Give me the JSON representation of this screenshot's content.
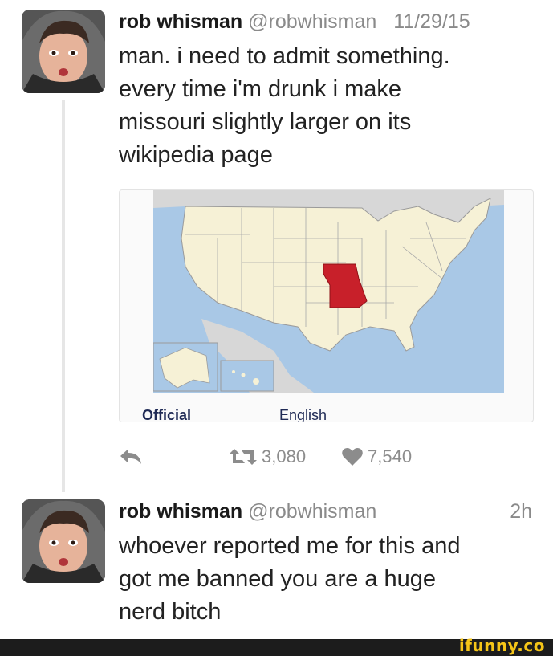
{
  "tweets": [
    {
      "name": "rob whisman",
      "handle": "@robwhisman",
      "time": "11/29/15",
      "lines": [
        "man. i need to admit something.",
        "every time i'm drunk i make",
        "missouri slightly larger on its",
        "wikipedia page"
      ],
      "card": {
        "tabs": [
          "Official",
          "English"
        ]
      },
      "actions": {
        "retweets": "3,080",
        "likes": "7,540"
      }
    },
    {
      "name": "rob whisman",
      "handle": "@robwhisman",
      "time": "2h",
      "lines": [
        "whoever reported me for this and",
        "got me banned you are a huge",
        "nerd bitch"
      ]
    }
  ],
  "watermark": "ifunny.co",
  "colors": {
    "missouri": "#c8202a",
    "land": "#f6f1d6",
    "water": "#a9c8e6",
    "meta_gray": "#8a8a8a",
    "watermark": "#f5c518"
  }
}
